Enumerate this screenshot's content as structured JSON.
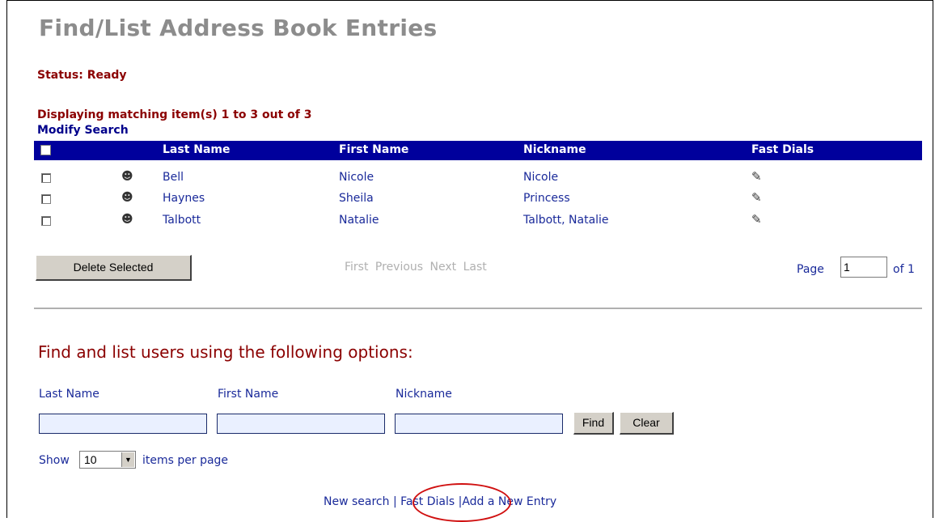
{
  "page": {
    "title": "Find/List Address Book Entries",
    "status": "Status: Ready",
    "display_summary": "Displaying matching item(s) 1 to 3 out of 3",
    "modify_search": "Modify Search"
  },
  "table": {
    "columns": [
      "Last Name",
      "First Name",
      "Nickname",
      "Fast Dials"
    ],
    "rows": [
      {
        "last": "Bell",
        "first": "Nicole",
        "nickname": "Nicole"
      },
      {
        "last": "Haynes",
        "first": "Sheila",
        "nickname": "Princess"
      },
      {
        "last": "Talbott",
        "first": "Natalie",
        "nickname": "Talbott, Natalie"
      }
    ],
    "row_icon": "person-icon",
    "fast_dial_icon": "edit-fast-dial-icon"
  },
  "pagination": {
    "delete_label": "Delete Selected",
    "first": "First",
    "previous": "Previous",
    "next": "Next",
    "last": "Last",
    "page_label": "Page",
    "page_value": "1",
    "of_label": "of 1"
  },
  "find": {
    "heading": "Find and list users using the following options:",
    "last_name_label": "Last Name",
    "first_name_label": "First Name",
    "nickname_label": "Nickname",
    "find_label": "Find",
    "clear_label": "Clear",
    "show_label": "Show",
    "per_page_value": "10",
    "items_per_page_label": "items per page"
  },
  "footer": {
    "new_search": "New search",
    "sep1": "|",
    "fast_dials": "Fast Dials",
    "sep2": "|",
    "add_entry": "Add a New Entry"
  },
  "colors": {
    "header_bg": "#00009c",
    "status_red": "#8b0000",
    "link_blue": "#1a2a9a",
    "highlight_ellipse": "#d01010"
  }
}
